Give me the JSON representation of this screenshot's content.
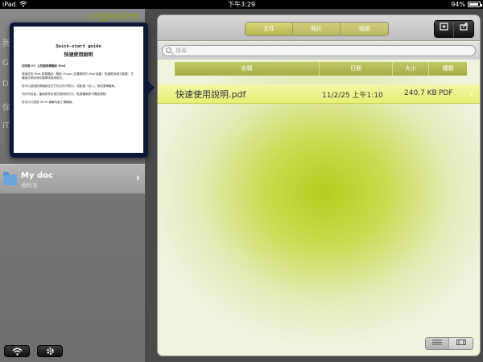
{
  "status_bar": {
    "carrier": "iPad",
    "time": "下午3:29",
    "battery": "94%"
  },
  "sidebar": {
    "logo_text": "organize",
    "stubs": [
      "我",
      "G",
      "D",
      "保",
      "iT"
    ],
    "folder": {
      "title": "My doc",
      "subtitle": "資料夾"
    }
  },
  "preview": {
    "title": "Quick-start guide",
    "subtitle": "快速使用說明",
    "lines": [
      "如何將 PC 上的檔案傳輸到 iPad",
      "連接您的 iPad 到電腦後，開啟 iTunes 並選擇您的 iPad 裝置，點選應用程式頁籤，在檔案共享區塊中選擇本應用程式。",
      "您可以直接拖曳檔案至右方的文件列表中，或點選「加入」按鈕選擇檔案。",
      "同步完成後，檔案即會出現在應用程式中，點選檔案即可開啟預覽。",
      "您也可以透過 Wi-Fi 傳輸功能上傳檔案。"
    ]
  },
  "toolbar": {
    "tabs": [
      "文件",
      "照片",
      "視頻"
    ],
    "active_tab": 0
  },
  "search": {
    "placeholder": "搜尋"
  },
  "table": {
    "headers": [
      "名稱",
      "日期",
      "大小",
      "種類"
    ],
    "rows": [
      {
        "name": "快速使用說明.pdf",
        "date": "11/2/25 上午1:10",
        "size": "240.7 KB",
        "kind": "PDF"
      }
    ]
  },
  "colors": {
    "accent": "#b6cc1e",
    "header": "#a5ad45",
    "selected_row": "#e6ef72"
  }
}
